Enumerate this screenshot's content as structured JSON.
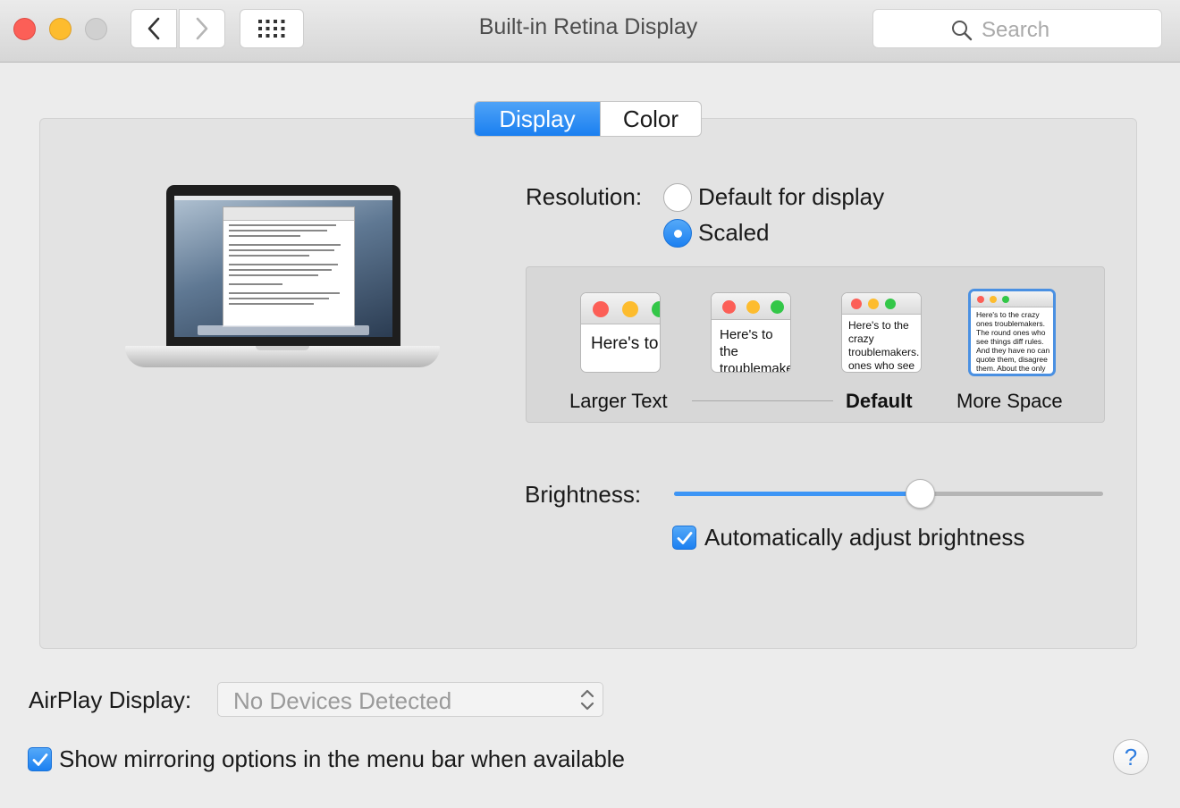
{
  "window": {
    "title": "Built-in Retina Display",
    "search_placeholder": "Search"
  },
  "tabs": [
    {
      "label": "Display",
      "selected": true
    },
    {
      "label": "Color",
      "selected": false
    }
  ],
  "resolution": {
    "label": "Resolution:",
    "options": [
      {
        "label": "Default for display",
        "selected": false
      },
      {
        "label": "Scaled",
        "selected": true
      }
    ]
  },
  "scaled_options": [
    {
      "label": "Larger Text",
      "preview": "Here's to the troublemakers",
      "selected": false,
      "bold": false
    },
    {
      "label": "",
      "preview": "Here's to the troublemakers ones who",
      "selected": false,
      "bold": false
    },
    {
      "label": "Default",
      "preview": "Here's to the crazy troublemakers. ones who see things rules. And they",
      "selected": false,
      "bold": true
    },
    {
      "label": "More Space",
      "preview": "Here's to the crazy ones troublemakers. The round ones who see things diff rules. And they have no can quote them, disagree them. About the only thing Because they change things",
      "selected": true,
      "bold": false
    }
  ],
  "brightness": {
    "label": "Brightness:",
    "level": 0.57,
    "auto_label": "Automatically adjust brightness",
    "auto_checked": true
  },
  "airplay": {
    "label": "AirPlay Display:",
    "value": "No Devices Detected"
  },
  "mirroring": {
    "label": "Show mirroring options in the menu bar when available",
    "checked": true
  },
  "help_label": "?",
  "colors": {
    "accent": "#1a7ff0",
    "close": "#fc5f57",
    "minimize": "#fdbc2e",
    "zoom_disabled": "#d0d0d0"
  }
}
